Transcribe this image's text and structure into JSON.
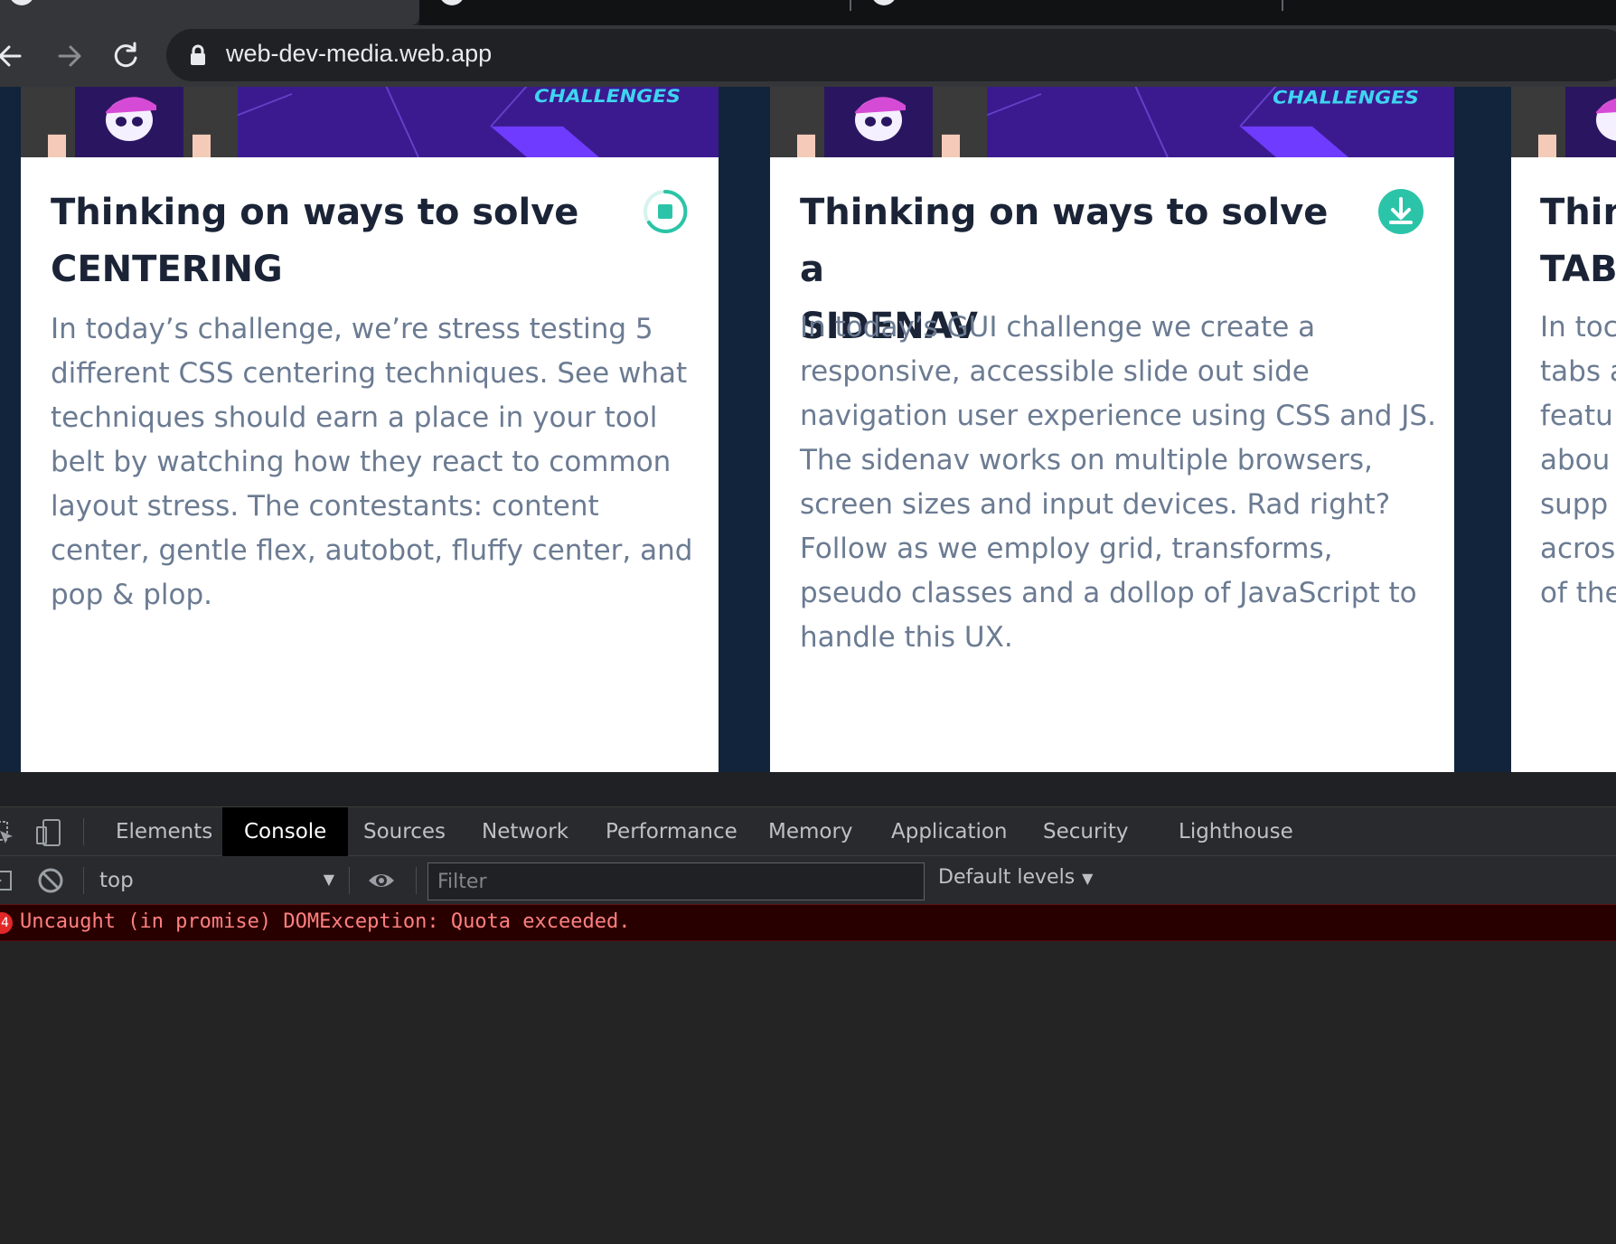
{
  "browser": {
    "url": "web-dev-media.web.app",
    "back_icon": "arrow-left-icon",
    "forward_icon": "arrow-right-icon",
    "reload_icon": "reload-icon",
    "lock_icon": "lock-icon"
  },
  "cards": [
    {
      "thumb_text": "CHALLENGES",
      "title_line1": "Thinking on ways to solve",
      "title_line2": "CENTERING",
      "description": "In today’s challenge, we’re stress testing 5 different CSS centering techniques. See what techniques should earn a place in your tool belt by watching how they react to common layout stress. The contestants: content center, gentle flex, autobot, fluffy center, and pop & plop.",
      "status_icon": "stop-download-icon"
    },
    {
      "thumb_text": "CHALLENGES",
      "title_line1": "Thinking on ways to solve a",
      "title_line2": "SIDENAV",
      "description": "In today’s GUI challenge we create a responsive, accessible slide out side navigation user experience using CSS and JS. The sidenav works on multiple browsers, screen sizes and input devices. Rad right? Follow as we employ grid, transforms, pseudo classes and a dollop of JavaScript to handle this UX.",
      "status_icon": "download-icon"
    },
    {
      "title_line1": "Thin",
      "title_line2": "TAB",
      "description_lines": [
        "In toc",
        "tabs a",
        "featu",
        "abou",
        "supp",
        "acros",
        "of the"
      ]
    }
  ],
  "devtools": {
    "tabs": [
      "Elements",
      "Console",
      "Sources",
      "Network",
      "Performance",
      "Memory",
      "Application",
      "Security",
      "Lighthouse"
    ],
    "active_tab": "Console",
    "context": "top",
    "filter_placeholder": "Filter",
    "levels_label": "Default levels",
    "error_count": "4",
    "error_message": "Uncaught (in promise) DOMException: Quota exceeded."
  },
  "colors": {
    "page_bg": "#11243b",
    "accent_teal": "#2bc4a8",
    "thumb_purple": "#3b1a8f",
    "error_text": "#ff8080"
  }
}
